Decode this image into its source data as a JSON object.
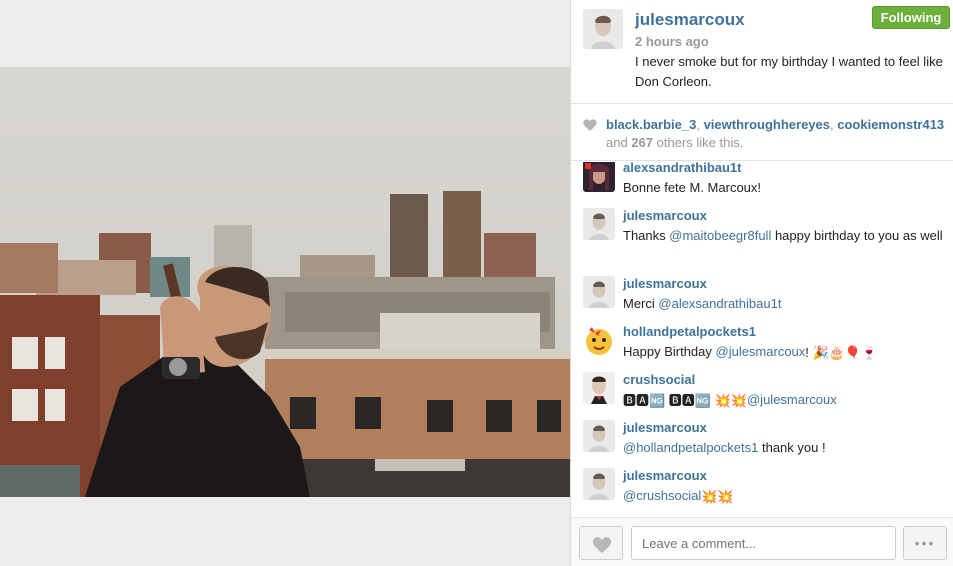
{
  "post": {
    "username": "julesmarcoux",
    "time_ago": "2 hours ago",
    "caption": "I never smoke but for my birthday I wanted to feel like Don Corleon.",
    "follow_label": "Following"
  },
  "likes": {
    "users": [
      "black.barbie_3",
      "viewthroughhereyes",
      "cookiemonstr413"
    ],
    "sep1": ", ",
    "sep2": ", ",
    "and": " and ",
    "count": "267",
    "suffix": " others like this."
  },
  "comments": [
    {
      "user": "alexsandrathibau1t",
      "text": "Bonne fete M. Marcoux!"
    },
    {
      "user": "julesmarcoux",
      "mention": "@maitobeegr8full",
      "prefix": "Thanks ",
      "text": " happy birthday to you as well"
    },
    {
      "user": "julesmarcoux",
      "prefix": "Merci ",
      "mention": "@alexsandrathibau1t"
    },
    {
      "user": "hollandpetalpockets1",
      "prefix": "Happy Birthday ",
      "mention": "@julesmarcoux",
      "emoji": "! 🎉🎂🎈🍷"
    },
    {
      "user": "crushsocial",
      "emoji": "🅱🅰🆖 🅱🅰🆖 💥💥 ",
      "mention": "@julesmarcoux"
    },
    {
      "user": "julesmarcoux",
      "mention": "@hollandpetalpockets1",
      "text": " thank you !"
    },
    {
      "user": "julesmarcoux",
      "mention": "@crushsocial",
      "emoji": " 💥💥"
    }
  ],
  "composer": {
    "placeholder": "Leave a comment...",
    "more_label": "•••"
  },
  "icons": {
    "heart": "heart-icon",
    "more": "more-options-icon"
  },
  "colors": {
    "link": "#3f729b",
    "follow_bg": "#6bb03b",
    "muted": "#999999"
  }
}
